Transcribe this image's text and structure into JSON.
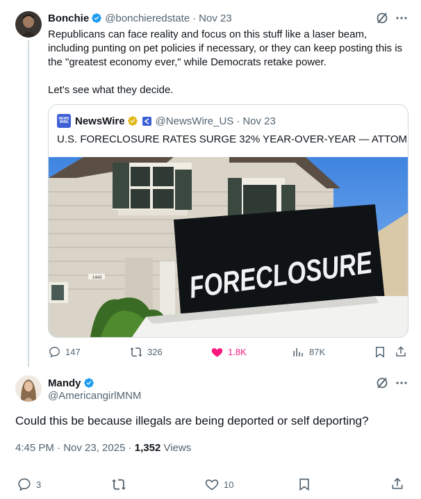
{
  "tweet": {
    "author_name": "Bonchie",
    "author_handle": "@bonchieredstate",
    "date": "Nov 23",
    "text_paragraph_1": "Republicans can face reality and focus on this stuff like a laser beam, including punting on pet policies if necessary, or they can keep posting this is the \"greatest economy ever,\" while Democrats retake power.",
    "text_paragraph_2": "Let's see what they decide.",
    "quoted": {
      "logo_text": "NEWS WIRE",
      "author_name": "NewsWire",
      "author_handle": "@NewsWire_US",
      "date": "Nov 23",
      "text": "U.S. FORECLOSURE RATES SURGE 32% YEAR-OVER-YEAR — ATTOM",
      "image_sign_text": "FORECLOSURE",
      "house_number": "1443"
    },
    "stats": {
      "replies": "147",
      "reposts": "326",
      "likes": "1.8K",
      "views": "87K"
    }
  },
  "reply": {
    "author_name": "Mandy",
    "author_handle": "@AmericangirlMNM",
    "text": "Could this be because illegals are being deported or self deporting?",
    "time_date": "4:45 PM · Nov 23, 2025 · ",
    "views_count": "1,352",
    "views_label": " Views",
    "stats": {
      "replies": "3",
      "likes": "10"
    }
  },
  "colors": {
    "verified_blue": "#1d9bf0",
    "verified_gold": "#e2b719",
    "like_pink": "#f91880",
    "muted": "#536471"
  }
}
